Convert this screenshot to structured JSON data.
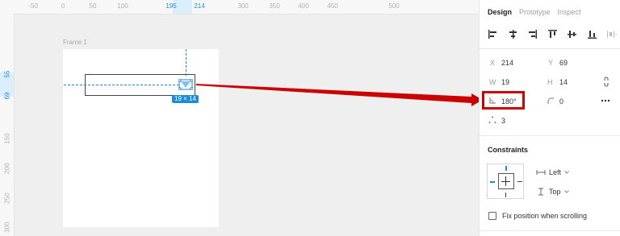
{
  "canvas": {
    "ruler_x_ticks": [
      "-50",
      "0",
      "50",
      "100",
      "195",
      "214",
      "300",
      "350",
      "400",
      "450",
      "500"
    ],
    "ruler_y_ticks": [
      "55",
      "69",
      "150",
      "200",
      "250",
      "300"
    ],
    "frame_label": "Frame 1",
    "size_badge": "19 × 14"
  },
  "panel": {
    "tabs": [
      {
        "label": "Design",
        "active": true
      },
      {
        "label": "Prototype",
        "active": false
      },
      {
        "label": "Inspect",
        "active": false
      }
    ],
    "align_icons": [
      "align-left-icon",
      "align-horizontal-center-icon",
      "align-right-icon",
      "align-top-icon",
      "align-vertical-center-icon",
      "align-bottom-icon",
      "distribute-icon"
    ],
    "x_label": "X",
    "x_value": "214",
    "y_label": "Y",
    "y_value": "69",
    "w_label": "W",
    "w_value": "19",
    "h_label": "H",
    "h_value": "14",
    "rotation_value": "180°",
    "corner_radius_value": "0",
    "corner_points_value": "3",
    "constraints_title": "Constraints",
    "horizontal_constraint": "Left",
    "vertical_constraint": "Top",
    "fix_position_label": "Fix position when scrolling"
  },
  "colors": {
    "selection_blue": "#1a8cd8",
    "annotation_red": "#cc0000"
  }
}
